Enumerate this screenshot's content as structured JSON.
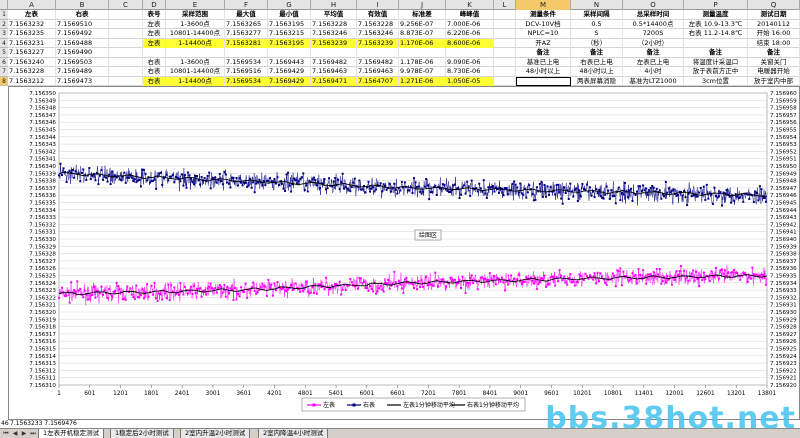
{
  "columns": [
    "A",
    "B",
    "C",
    "D",
    "E",
    "F",
    "G",
    "H",
    "I",
    "J",
    "K",
    "L",
    "M",
    "N",
    "O",
    "P",
    "Q"
  ],
  "selected_column": "M",
  "rows": [
    "1",
    "2",
    "3",
    "4",
    "5",
    "6",
    "7",
    "8",
    "9",
    "10",
    "11",
    "12",
    "13",
    "14",
    "15",
    "16",
    "17",
    "18",
    "19",
    "20",
    "21",
    "22",
    "23",
    "24",
    "25",
    "26",
    "27",
    "28",
    "29",
    "30",
    "31",
    "32",
    "33",
    "34",
    "35",
    "36",
    "37",
    "38",
    "39",
    "40",
    "41",
    "42",
    "43",
    "44",
    "45",
    "46",
    "47"
  ],
  "selected_row": "8",
  "sheet": {
    "r1": [
      "左表",
      "右表",
      "",
      "表号",
      "采样范围",
      "最大值",
      "最小值",
      "平均值",
      "有效值",
      "标准差",
      "峰峰值",
      "",
      "测量条件",
      "采样间隔",
      "总采样时间",
      "测量温度",
      "测试日期"
    ],
    "r2": [
      "7.1563232",
      "7.1569510",
      "",
      "左表",
      "1-3600点",
      "7.1563265",
      "7.1563195",
      "7.1563228",
      "7.1563228",
      "9.256E-07",
      "7.000E-06",
      "",
      "DCV-10V档",
      "0.5",
      "0.5*14400点",
      "左表  10.9-13.3℃",
      "20140112"
    ],
    "r3": [
      "7.1563235",
      "7.1569492",
      "",
      "左表",
      "10801-14400点",
      "7.1563277",
      "7.1563215",
      "7.1563246",
      "7.1563246",
      "8.873E-07",
      "6.220E-06",
      "",
      "NPLC=10",
      "S",
      "7200S",
      "右表  11.2-14.8℃",
      "开始 16:00"
    ],
    "r4": [
      "7.1563231",
      "7.1569488",
      "",
      "左表",
      "1-14400点",
      "7.1563281",
      "7.1563195",
      "7.1563239",
      "7.1563239",
      "1.170E-06",
      "8.600E-06",
      "",
      "开AZ",
      "（秒）",
      "（2小时）",
      "",
      "结束 18:00"
    ],
    "r5": [
      "7.1563227",
      "7.1569490",
      "",
      "",
      "",
      "",
      "",
      "",
      "",
      "",
      "",
      "",
      "备注",
      "备注",
      "备注",
      "备注",
      "备注"
    ],
    "r6": [
      "7.1563240",
      "7.1569503",
      "",
      "右表",
      "1-3600点",
      "7.1569534",
      "7.1569443",
      "7.1569482",
      "7.1569482",
      "1.178E-06",
      "9.090E-06",
      "",
      "基准已上电",
      "右表已上电",
      "左表已上电",
      "将温度计采温口",
      "关窗关门"
    ],
    "r7": [
      "7.1563228",
      "7.1569489",
      "",
      "右表",
      "10801-14400点",
      "7.1569516",
      "7.1569429",
      "7.1569463",
      "7.1569463",
      "9.978E-07",
      "8.730E-06",
      "",
      "48小时以上",
      "48小时以上",
      "4小时",
      "放于表前方正中",
      "电暖器开始"
    ],
    "r8": [
      "7.1563212",
      "7.1569473",
      "",
      "右表",
      "1-14400点",
      "7.1569534",
      "7.1569429",
      "7.1569471",
      "7.1564707",
      "1.271E-06",
      "1.050E-05",
      "",
      "",
      "两表屏幕消隐",
      "基准为LTZ1000",
      "3cm位置",
      "放于室内中部"
    ]
  },
  "chart_data": {
    "type": "line",
    "xlabel": "",
    "ylabel": "",
    "x_ticks": [
      "1",
      "601",
      "1201",
      "1801",
      "2401",
      "3001",
      "3601",
      "4201",
      "4801",
      "5401",
      "6001",
      "6601",
      "7201",
      "7801",
      "8401",
      "9001",
      "9601",
      "10201",
      "10801",
      "11401",
      "12001",
      "12601",
      "13201",
      "13801"
    ],
    "x_range": [
      1,
      14400
    ],
    "y_left_ticks": [
      "7.156350",
      "7.156349",
      "7.156348",
      "7.156347",
      "7.156346",
      "7.156345",
      "7.156344",
      "7.156343",
      "7.156342",
      "7.156341",
      "7.156340",
      "7.156339",
      "7.156338",
      "7.156337",
      "7.156336",
      "7.156335",
      "7.156334",
      "7.156333",
      "7.156332",
      "7.156331",
      "7.156330",
      "7.156329",
      "7.156328",
      "7.156327",
      "7.156326",
      "7.156325",
      "7.156324",
      "7.156323",
      "7.156322",
      "7.156321",
      "7.156320",
      "7.156319",
      "7.156318",
      "7.156317",
      "7.156316",
      "7.156315",
      "7.156314",
      "7.156313",
      "7.156312",
      "7.156311",
      "7.156310"
    ],
    "y_left_range": [
      7.15631,
      7.15635
    ],
    "y_right_ticks": [
      "7.156960",
      "7.156959",
      "7.156958",
      "7.156957",
      "7.156956",
      "7.156955",
      "7.156954",
      "7.156953",
      "7.156952",
      "7.156951",
      "7.156950",
      "7.156949",
      "7.156948",
      "7.156947",
      "7.156946",
      "7.156945",
      "7.156944",
      "7.156943",
      "7.156942",
      "7.156941",
      "7.156940",
      "7.156939",
      "7.156938",
      "7.156937",
      "7.156936",
      "7.156935",
      "7.156934",
      "7.156933",
      "7.156932",
      "7.156931",
      "7.156930",
      "7.156929",
      "7.156928",
      "7.156927",
      "7.156926",
      "7.156925",
      "7.156924",
      "7.156923",
      "7.156922",
      "7.156921",
      "7.156920"
    ],
    "y_right_range": [
      7.15692,
      7.15696
    ],
    "plot_area_label": "绘图区",
    "series": [
      {
        "name": "左表",
        "axis": "left",
        "color": "#ff00ff",
        "x": [
          1,
          3601,
          7201,
          10801,
          14400
        ],
        "mean": [
          7.1563225,
          7.156323,
          7.156324,
          7.1563246,
          7.156325
        ],
        "spread": 1.4e-06
      },
      {
        "name": "右表",
        "axis": "right",
        "color": "#000080",
        "x": [
          1,
          3601,
          7201,
          10801,
          14400
        ],
        "mean": [
          7.156949,
          7.156948,
          7.156947,
          7.1569465,
          7.156946
        ],
        "spread": 1.6e-06
      },
      {
        "name": "左表1分钟移动平均",
        "axis": "left",
        "color": "#000000",
        "x": [
          1,
          3601,
          7201,
          10801,
          14400
        ],
        "mean": [
          7.1563225,
          7.156323,
          7.156324,
          7.1563246,
          7.156325
        ],
        "spread": 2e-07
      },
      {
        "name": "右表1分钟移动平均",
        "axis": "right",
        "color": "#000000",
        "x": [
          1,
          3601,
          7201,
          10801,
          14400
        ],
        "mean": [
          7.156949,
          7.156948,
          7.156947,
          7.1569465,
          7.156946
        ],
        "spread": 2e-07
      }
    ]
  },
  "below_chart_rows": {
    "r46": "7.1563233   7.1569476",
    "r47": ""
  },
  "tabs": [
    "1左表开机稳定测试",
    "1稳定后2小时测试",
    "2室内升温2小时测试",
    "2室内降温4小时测试"
  ],
  "active_tab": 0,
  "watermark": "bbs.38hot.net"
}
